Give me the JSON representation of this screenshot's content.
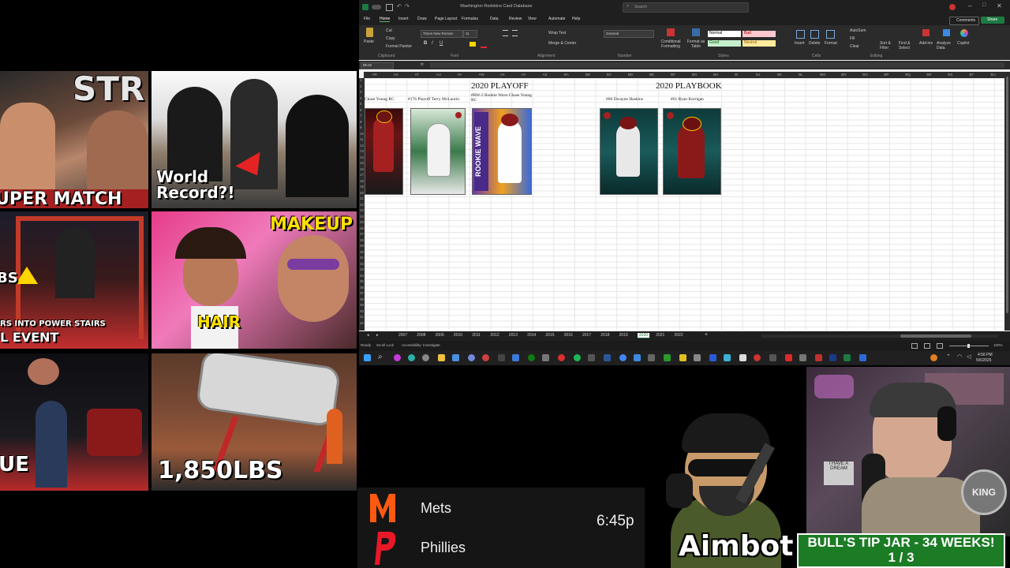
{
  "thumbnails": {
    "t1": {
      "caption": "STR",
      "caption2": "UPER MATCH"
    },
    "t2": {
      "caption": "World Record?!"
    },
    "t3": {
      "caption": "BS",
      "caption2": "RS INTO POWER STAIRS",
      "caption3": "L EVENT"
    },
    "t4": {
      "caption": "MAKEUP",
      "caption2": "HAIR"
    },
    "t5": {
      "caption": "UE"
    },
    "t6": {
      "caption": "1,850LBS"
    }
  },
  "excel": {
    "window_title": "Washington Redskins Card Database",
    "search_placeholder": "Search",
    "comments_label": "Comments",
    "share_label": "Share",
    "menu": [
      "File",
      "Home",
      "Insert",
      "Draw",
      "Page Layout",
      "Formulas",
      "Data",
      "Review",
      "View",
      "Automate",
      "Help"
    ],
    "ribbon": {
      "paste": "Paste",
      "cut": "Cut",
      "copy": "Copy",
      "format_painter": "Format Painter",
      "clipboard": "Clipboard",
      "font_name": "Times New Roman",
      "font_size": "11",
      "font_group": "Font",
      "wrap_text": "Wrap Text",
      "merge_center": "Merge & Center",
      "alignment": "Alignment",
      "number_format": "General",
      "number": "Number",
      "conditional": "Conditional Formatting",
      "format_table": "Format as Table",
      "style_normal": "Normal",
      "style_bad": "Bad",
      "style_good": "Good",
      "style_neutral": "Neutral",
      "styles": "Styles",
      "insert": "Insert",
      "delete": "Delete",
      "format": "Format",
      "cells": "Cells",
      "autosum": "AutoSum",
      "fill": "Fill",
      "clear": "Clear",
      "sort_filter": "Sort & Filter",
      "find_select": "Find & Select",
      "editing": "Editing",
      "addins": "Add-ins",
      "analyze": "Analyze Data",
      "copilot": "Copilot"
    },
    "name_box": "BK15",
    "fx": "fx",
    "column_headers": [
      "AR",
      "AS",
      "AT",
      "AU",
      "AV",
      "AW",
      "AX",
      "AY",
      "AZ",
      "BA",
      "BB",
      "BC",
      "BD",
      "BE",
      "BF",
      "BG",
      "BH",
      "BI",
      "BJ",
      "BK",
      "BL",
      "BM",
      "BN",
      "BO",
      "BP",
      "BQ",
      "BR",
      "BS",
      "BT",
      "BU"
    ],
    "row_headers": [
      "1",
      "2",
      "3",
      "4",
      "5",
      "6",
      "7",
      "8",
      "9",
      "10",
      "11",
      "12",
      "13",
      "14",
      "15",
      "16",
      "17",
      "18",
      "19",
      "20",
      "21",
      "22",
      "23",
      "24",
      "25",
      "26",
      "27",
      "28",
      "29",
      "30",
      "31",
      "32",
      "33",
      "34",
      "35",
      "36",
      "37",
      "38",
      "39",
      "40",
      "41",
      "42"
    ],
    "section_playoff": "2020 PLAYOFF",
    "section_playbook": "2020 PLAYBOOK",
    "cards": {
      "c1": "Chase Young RC",
      "c2": "#176 Playoff Terry McLaurin",
      "c3": "#RW-2 Rookie Wave Chase Young RC",
      "c4": "#60 Dwayne Haskins",
      "c5": "#61 Ryan Kerrigan"
    },
    "sheet_tabs": [
      "2007",
      "2008",
      "2009",
      "2010",
      "2011",
      "2012",
      "2013",
      "2014",
      "2015",
      "2016",
      "2017",
      "2018",
      "2019",
      "2020",
      "2021",
      "2022"
    ],
    "active_tab": "2020",
    "status_ready": "Ready",
    "status_scroll": "Scroll Lock",
    "status_access": "Accessibility: Investigate",
    "zoom": "100%"
  },
  "taskbar": {
    "time": "4:56 PM",
    "date": "5/6/2025"
  },
  "scoreboard": {
    "team1": "Mets",
    "team2": "Phillies",
    "time": "6:45p",
    "colors": {
      "mets": "#ff5910",
      "phillies": "#e81828"
    }
  },
  "overlay": {
    "mascot_name": "Aimbot",
    "tip_line1": "BULL'S TIP JAR - 34 WEEKS!",
    "tip_line2": "1 / 3",
    "webcam_sign": "I HAVE A DREAM",
    "logo_text": "KING"
  }
}
